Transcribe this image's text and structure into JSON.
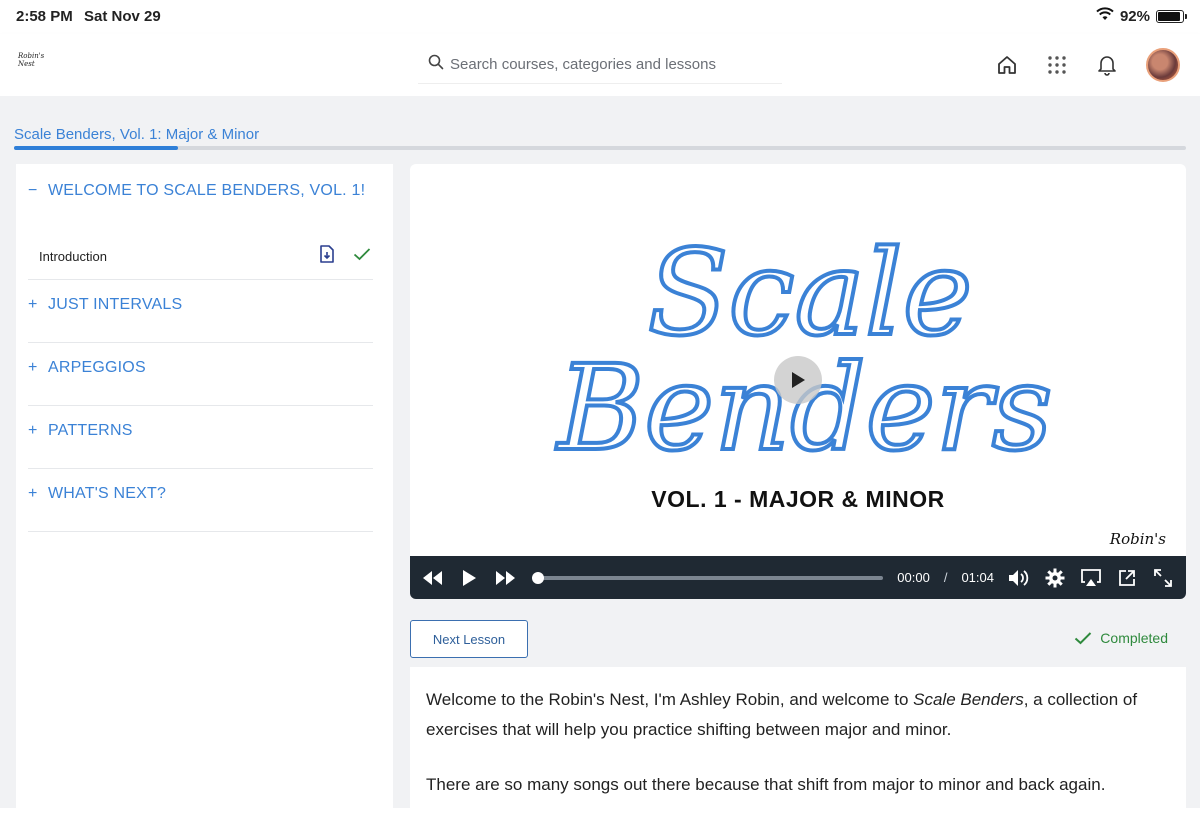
{
  "status_bar": {
    "time": "2:58 PM",
    "date": "Sat Nov 29",
    "battery": "92%",
    "battery_level": 0.92
  },
  "header": {
    "logo_text": "Robin's Nest",
    "search_placeholder": "Search courses, categories and lessons",
    "icons": [
      "home-icon",
      "apps-grid-icon",
      "bell-icon",
      "avatar"
    ]
  },
  "course": {
    "title": "Scale Benders, Vol. 1: Major & Minor",
    "progress": 0.14
  },
  "sidebar": {
    "sections": [
      {
        "sign": "−",
        "label": "WELCOME TO SCALE BENDERS, VOL. 1!",
        "expanded": true
      },
      {
        "sign": "+",
        "label": "JUST INTERVALS",
        "expanded": false
      },
      {
        "sign": "+",
        "label": "ARPEGGIOS",
        "expanded": false
      },
      {
        "sign": "+",
        "label": "PATTERNS",
        "expanded": false
      },
      {
        "sign": "+",
        "label": "WHAT'S NEXT?",
        "expanded": false
      }
    ],
    "lessons": [
      {
        "label": "Introduction",
        "completed": true
      }
    ]
  },
  "video": {
    "art_title_line1": "Scale",
    "art_title_line2": "Benders",
    "subtitle": "VOL. 1 - MAJOR & MINOR",
    "brand": "Robin's",
    "current_time": "00:00",
    "separator": "/",
    "duration": "01:04",
    "progress": 0.0,
    "accent_color": "#3b82d6"
  },
  "actions": {
    "next_label": "Next Lesson",
    "completed_label": "Completed"
  },
  "description": {
    "p1_before": "Welcome to the Robin's Nest, I'm Ashley Robin, and welcome to ",
    "p1_em": "Scale Benders",
    "p1_after": ", a collection of exercises that will help you practice shifting between major and minor.",
    "p2": "There are so many songs out there because that shift from major to minor and back again. Whenever you"
  }
}
